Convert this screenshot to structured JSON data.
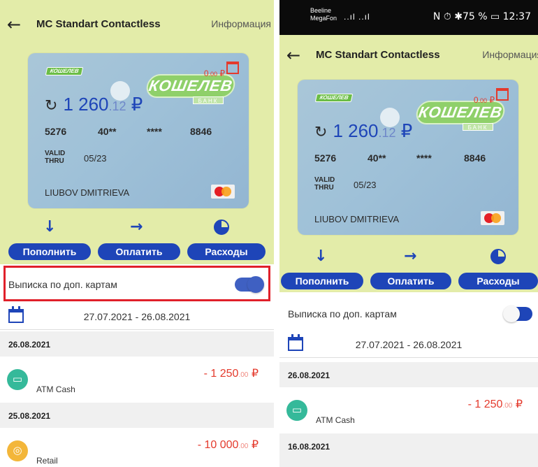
{
  "colors": {
    "accent_blue": "#1e45b8",
    "header_green": "#e3eca9",
    "expense_red": "#e43a2c",
    "highlight_red": "#e0202a"
  },
  "status_bar": {
    "operator_1": "Beeline",
    "operator_2": "MegaFon",
    "signal_icons": "..ıl ..ıl",
    "right_text": "N ⏱ ✱75 % ▭ 12:37"
  },
  "header": {
    "back_icon": "←",
    "title": "MC Standart Contactless",
    "info": "Информация"
  },
  "card": {
    "small_logo": "КОШЕЛЕВ",
    "bank_logo": "КОШЕЛЕВ",
    "bank_sub": "БАНК",
    "bonus_main": "0",
    "bonus_cents": ".00",
    "bonus_currency": "₽",
    "refresh_icon": "↻",
    "balance_main": "1 260",
    "balance_cents": ".12",
    "balance_currency": "₽",
    "number_groups": [
      "5276",
      "40**",
      "****",
      "8846"
    ],
    "valid_label_1": "VALID",
    "valid_label_2": "THRU",
    "expiry": "05/23",
    "holder": "LIUBOV DMITRIEVA",
    "brand_icon": "mastercard-icon"
  },
  "actions": {
    "topup_icon": "↓",
    "pay_icon": "→",
    "expenses_icon": "pie-chart-icon",
    "topup_label": "Пополнить",
    "pay_label": "Оплатить",
    "expenses_label": "Расходы"
  },
  "statement_toggle": {
    "label": "Выписка по доп. картам",
    "left_state": "on",
    "right_state": "off"
  },
  "period": {
    "range": "27.07.2021 - 26.08.2021"
  },
  "left_transactions": [
    {
      "date": "26.08.2021",
      "name": "ATM Cash",
      "amount_main": "- 1 250",
      "amount_cents": ".00",
      "currency": "₽",
      "icon": "atm-cash-icon"
    },
    {
      "date": "25.08.2021",
      "name": "Retail",
      "amount_main": "- 10 000",
      "amount_cents": ".00",
      "currency": "₽",
      "icon": "retail-icon"
    }
  ],
  "right_transactions": [
    {
      "date": "26.08.2021",
      "name": "ATM Cash",
      "amount_main": "- 1 250",
      "amount_cents": ".00",
      "currency": "₽",
      "icon": "atm-cash-icon"
    }
  ],
  "right_next_date": "16.08.2021"
}
